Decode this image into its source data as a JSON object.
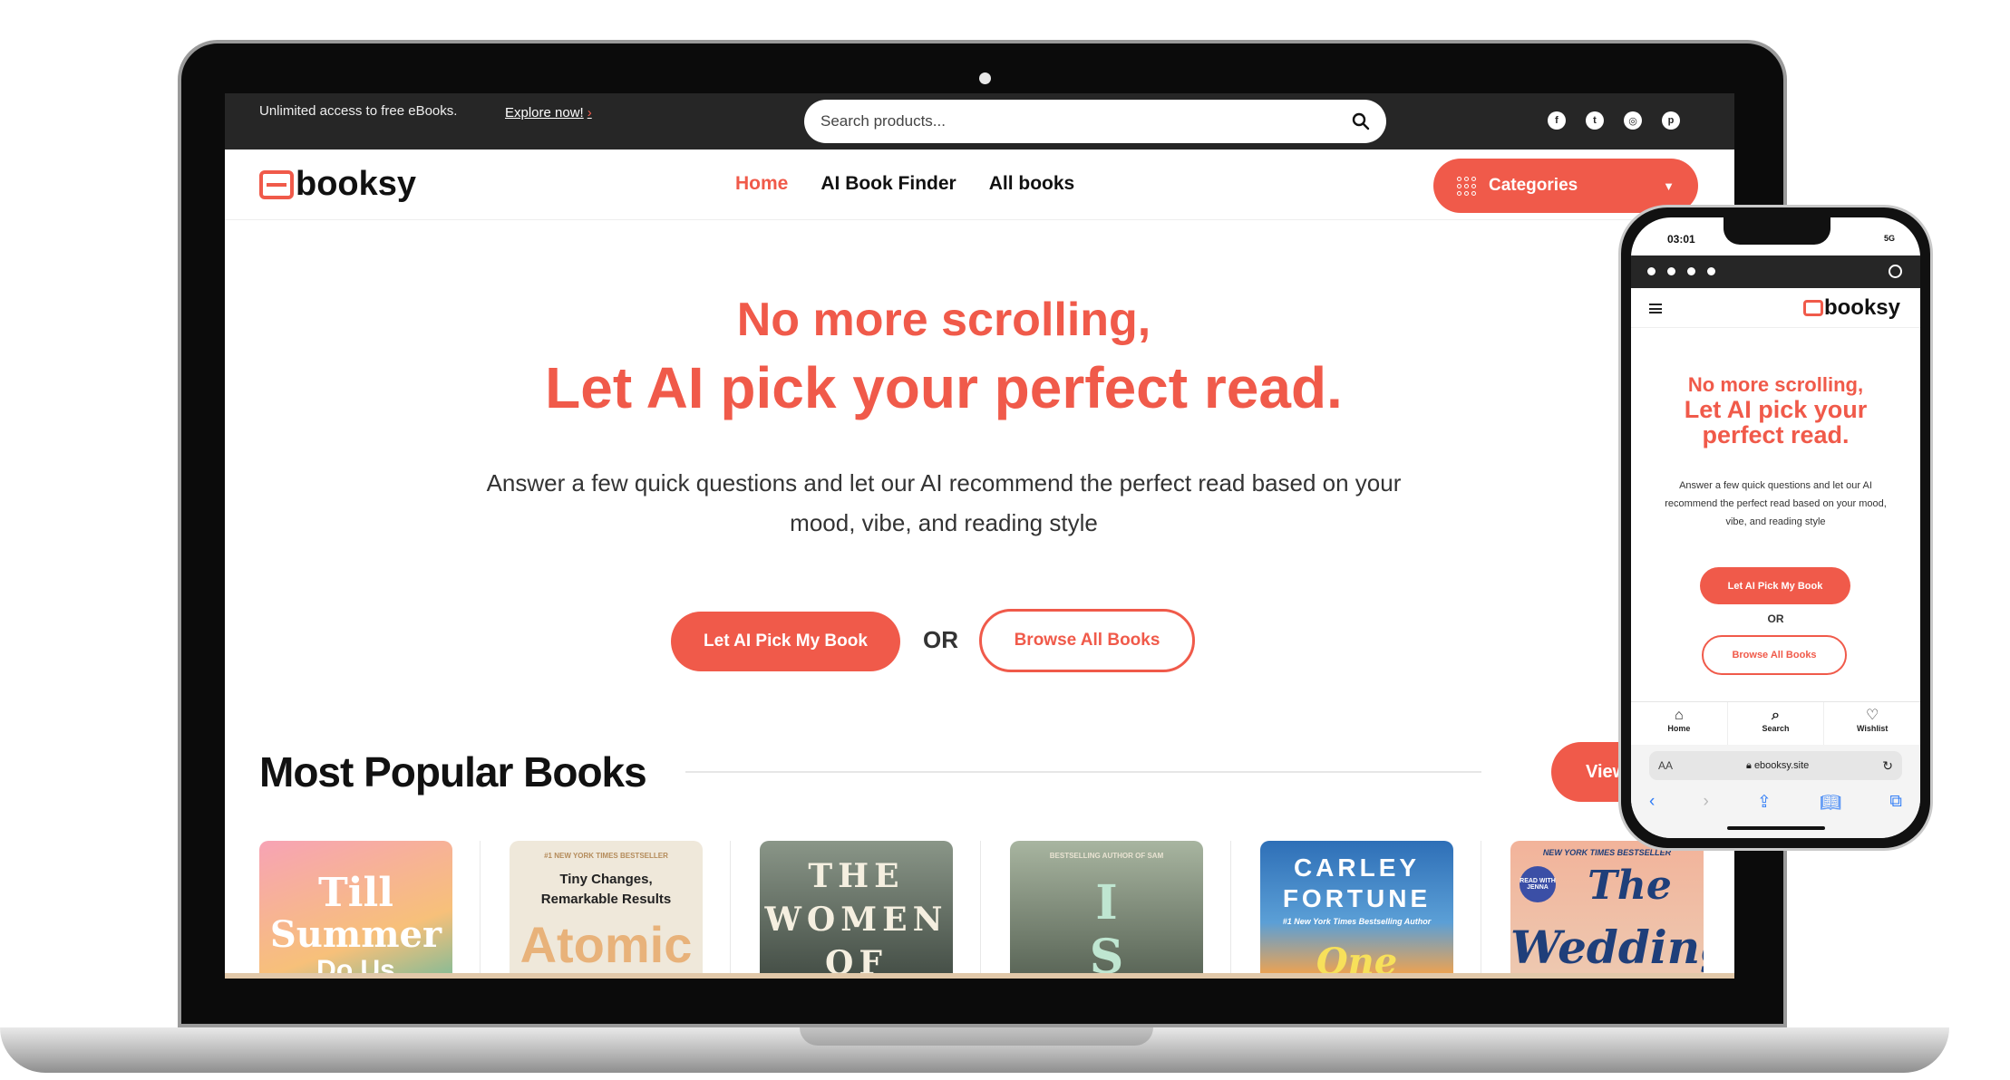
{
  "topbar": {
    "promo": "Unlimited access to free eBooks.",
    "explore": "Explore now!",
    "explore_arrow": "›",
    "search_placeholder": "Search products...",
    "social": [
      "facebook-icon",
      "twitter-icon",
      "instagram-icon",
      "pinterest-icon"
    ]
  },
  "brand": {
    "name": "booksy",
    "accent": "#f05a4a",
    "dark": "#262626"
  },
  "nav": {
    "items": [
      {
        "label": "Home",
        "active": true
      },
      {
        "label": "AI Book Finder",
        "active": false
      },
      {
        "label": "All books",
        "active": false
      }
    ],
    "categories_label": "Categories"
  },
  "hero": {
    "line1": "No more scrolling,",
    "line2": "Let AI pick your perfect read.",
    "subtitle": "Answer a few quick questions and let our AI recommend the perfect read based on your mood, vibe, and reading style",
    "primary_button": "Let AI Pick My Book",
    "or_label": "OR",
    "secondary_button": "Browse All Books"
  },
  "popular": {
    "title": "Most Popular Books",
    "view_label": "View",
    "books": [
      {
        "cover_text": [
          "Till",
          "Summer",
          "Do Us"
        ],
        "colors": [
          "#f7a3b5",
          "#3bb8a8"
        ]
      },
      {
        "cover_text": [
          "#1 NEW YORK TIMES BESTSELLER",
          "Tiny Changes,",
          "Remarkable Results",
          "Atomic"
        ],
        "colors": [
          "#efe8da",
          "#e8b27a"
        ]
      },
      {
        "cover_text": [
          "THE",
          "WOMEN",
          "OF"
        ],
        "colors": [
          "#5b6658",
          "#2d3630"
        ]
      },
      {
        "cover_text": [
          "BESTSELLING AUTHOR OF SAM",
          "I",
          "S"
        ],
        "colors": [
          "#8c9a86",
          "#3f4a3e"
        ]
      },
      {
        "cover_text": [
          "CARLEY",
          "FORTUNE",
          "#1 New York Times Bestselling Author",
          "One"
        ],
        "colors": [
          "#2e6fb7",
          "#f4a34b"
        ]
      },
      {
        "cover_text": [
          "NEW YORK TIMES BESTSELLER",
          "READ WITH JENNA",
          "The",
          "Wedding"
        ],
        "colors": [
          "#f2b39a",
          "#ecd0b8"
        ]
      }
    ]
  },
  "phone": {
    "time": "03:01",
    "signal": "5G",
    "brand": "booksy",
    "hero_line1": "No more scrolling,",
    "hero_line2": "Let AI pick your perfect read.",
    "subtitle": "Answer a few quick questions and let our AI recommend the perfect read based on your mood, vibe, and reading style",
    "primary_button": "Let AI Pick My Book",
    "or_label": "OR",
    "secondary_button": "Browse All Books",
    "tabs": [
      {
        "label": "Home",
        "icon": "home-icon"
      },
      {
        "label": "Search",
        "icon": "search-icon"
      },
      {
        "label": "Wishlist",
        "icon": "heart-icon"
      }
    ],
    "url_aa": "AA",
    "url": "ebooksy.site"
  }
}
